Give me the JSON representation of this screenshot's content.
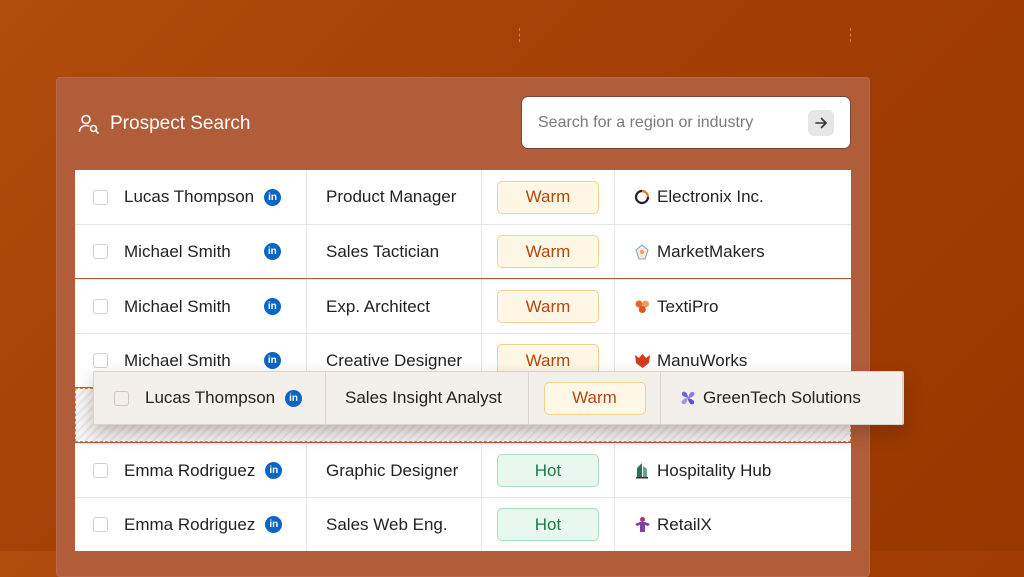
{
  "header": {
    "title": "Prospect Search",
    "icon": "user-search-icon"
  },
  "search": {
    "placeholder": "Search for a region or industry",
    "button_icon": "arrow-right-icon"
  },
  "rows": [
    {
      "name": "Lucas Thompson",
      "title": "Product Manager",
      "status": "Warm",
      "company": "Electronix Inc."
    },
    {
      "name": "Michael Smith",
      "title": "Sales Tactician",
      "status": "Warm",
      "company": "MarketMakers"
    },
    {
      "name": "Michael Smith",
      "title": "Exp. Architect",
      "status": "Warm",
      "company": "TextiPro"
    },
    {
      "name": "Michael Smith",
      "title": "Creative Designer",
      "status": "Warm",
      "company": "ManuWorks"
    },
    {
      "name": "Emma Rodriguez",
      "title": "Graphic Designer",
      "status": "Hot",
      "company": "Hospitality Hub"
    },
    {
      "name": "Emma Rodriguez",
      "title": "Sales Web Eng.",
      "status": "Hot",
      "company": "RetailX"
    }
  ],
  "dragged_row": {
    "name": "Lucas Thompson",
    "title": "Sales Insight Analyst",
    "status": "Warm",
    "company": "GreenTech Solutions"
  },
  "linkedin_label": "in",
  "colors": {
    "background": "#a43f05",
    "warm": "#b5470a",
    "hot": "#1f7a4a",
    "linkedin": "#0a66c2"
  }
}
